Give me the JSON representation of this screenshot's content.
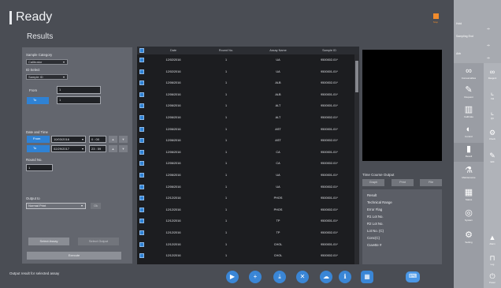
{
  "header": {
    "title": "Ready",
    "subtitle": "Results",
    "stop_label": "Stop"
  },
  "filters": {
    "sample_category_label": "Sample Category",
    "sample_category_value": "Calibrator",
    "id_select_label": "ID Select",
    "id_select_value": "Sample ID",
    "from_label": "From",
    "from_value": "1",
    "to_label": "To",
    "to_value": "1",
    "date_time_label": "Date and Time",
    "from_date": "10/03/2016",
    "from_time": "0 : 00",
    "to_date": "02/29/2017",
    "to_time": "23 : 59",
    "round_no_label": "Round No.",
    "round_no_value": "1",
    "output_to_label": "Output to",
    "output_to_value": "Normal Print",
    "output_btn": "Ok",
    "select_assay_btn": "Select Assay",
    "select_output_btn": "Select Output",
    "execute_btn": "Execute"
  },
  "table": {
    "columns": [
      "Date",
      "Round No.",
      "Assay Name",
      "Sample ID"
    ],
    "rows": [
      {
        "date": "12/02/2016",
        "round": "1",
        "assay": "UA",
        "sample": "9500002-01*"
      },
      {
        "date": "12/02/2016",
        "round": "1",
        "assay": "UA",
        "sample": "9500001-01*"
      },
      {
        "date": "12/06/2016",
        "round": "1",
        "assay": "ALB",
        "sample": "9500002-01*"
      },
      {
        "date": "12/06/2016",
        "round": "1",
        "assay": "ALB",
        "sample": "9500001-01*"
      },
      {
        "date": "12/06/2016",
        "round": "1",
        "assay": "ALT",
        "sample": "9500001-01*"
      },
      {
        "date": "12/06/2016",
        "round": "1",
        "assay": "ALT",
        "sample": "9500002-01*"
      },
      {
        "date": "12/06/2016",
        "round": "1",
        "assay": "AST",
        "sample": "9500001-01*"
      },
      {
        "date": "12/06/2016",
        "round": "1",
        "assay": "AST",
        "sample": "9500002-01*"
      },
      {
        "date": "12/06/2016",
        "round": "1",
        "assay": "CA",
        "sample": "9500001-01*"
      },
      {
        "date": "12/06/2016",
        "round": "1",
        "assay": "CA",
        "sample": "9500002-01*"
      },
      {
        "date": "12/06/2016",
        "round": "1",
        "assay": "UA",
        "sample": "9500001-01*"
      },
      {
        "date": "12/06/2016",
        "round": "1",
        "assay": "UA",
        "sample": "9500002-01*"
      },
      {
        "date": "12/12/2016",
        "round": "1",
        "assay": "PHOS",
        "sample": "9500001-01*"
      },
      {
        "date": "12/12/2016",
        "round": "1",
        "assay": "PHOS",
        "sample": "9500002-01*"
      },
      {
        "date": "12/12/2016",
        "round": "1",
        "assay": "TP",
        "sample": "9500001-01*"
      },
      {
        "date": "12/12/2016",
        "round": "1",
        "assay": "TP",
        "sample": "9500002-01*"
      },
      {
        "date": "12/12/2016",
        "round": "1",
        "assay": "CHOL",
        "sample": "9500001-01*"
      },
      {
        "date": "12/12/2016",
        "round": "1",
        "assay": "CHOL",
        "sample": "9500002-01*"
      }
    ]
  },
  "time_course": {
    "label": "Time Course Output",
    "buttons": [
      "Graph",
      "Print",
      "File"
    ],
    "items": [
      "Result",
      "Technical Range",
      "Error Flag",
      "R1 Lot No.",
      "R2 Lot No.",
      "Lot No. (C)",
      "Conc(C)",
      "Cuvette #"
    ]
  },
  "status": {
    "text": "Output result for selected assay"
  },
  "actions": [
    {
      "name": "start",
      "glyph": "▶"
    },
    {
      "name": "add",
      "glyph": "+"
    },
    {
      "name": "download",
      "glyph": "⤓"
    },
    {
      "name": "close",
      "glyph": "✕"
    },
    {
      "name": "cloud",
      "glyph": "☁"
    },
    {
      "name": "info",
      "glyph": "ℹ"
    },
    {
      "name": "grid",
      "glyph": "▦"
    },
    {
      "name": "keyboard",
      "glyph": "⌨"
    }
  ],
  "rail": {
    "top_labels": [
      "Hold",
      "Sampling End",
      "Abb"
    ],
    "items": [
      {
        "icon": "∞",
        "label": "Consumables"
      },
      {
        "icon": "✎",
        "label": "Request"
      },
      {
        "icon": "▥",
        "label": "Calibrate"
      },
      {
        "icon": "◐",
        "label": "Control"
      },
      {
        "icon": "▮",
        "label": "Result"
      },
      {
        "icon": "⚗",
        "label": "Maintenance"
      },
      {
        "icon": "▦",
        "label": "Status"
      },
      {
        "icon": "◎",
        "label": "System"
      },
      {
        "icon": "⚙",
        "label": "Setting"
      }
    ],
    "sub_items": [
      {
        "icon": "∞",
        "label": "Reagent"
      },
      {
        "icon": "⌞",
        "label": "Cal"
      },
      {
        "icon": "⌞",
        "label": "QC"
      },
      {
        "icon": "⚙",
        "label": "Check"
      },
      {
        "icon": "✎",
        "label": "Edit"
      },
      {
        "icon": "▲",
        "label": "Alarm"
      },
      {
        "icon": "⊓",
        "label": "Log"
      },
      {
        "icon": "⏻",
        "label": "Power"
      }
    ]
  }
}
